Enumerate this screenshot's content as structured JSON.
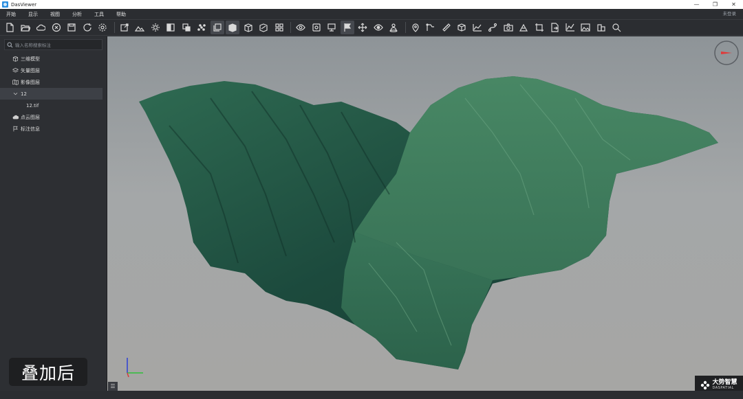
{
  "window": {
    "title": "DasViewer"
  },
  "menu": {
    "items": [
      "开始",
      "显示",
      "视图",
      "分析",
      "工具",
      "帮助"
    ],
    "login": "未登录"
  },
  "toolbar": {
    "groups": [
      [
        "file-new-icon",
        "folder-open-icon",
        "cloud-icon",
        "close-circle-icon",
        "save-icon",
        "refresh-icon",
        "settings-icon"
      ],
      [
        "export-icon",
        "terrain-icon",
        "light-icon",
        "layer-split-icon",
        "clip-icon",
        "point-cloud-icon",
        "stack-icon",
        "box-icon",
        "cube-frame-icon",
        "cube-cut-icon",
        "grid-icon"
      ],
      [
        "eye-icon",
        "frame-icon",
        "monitor-icon",
        "flag-pole-icon",
        "move-icon",
        "view-rotate-icon",
        "person-icon"
      ],
      [
        "pin-icon",
        "polyline-icon",
        "ruler-icon",
        "volume-icon",
        "profile-chart-icon",
        "route-icon",
        "camera-icon",
        "area-icon",
        "crop-icon",
        "file-export-icon",
        "chart-line-icon",
        "image-icon",
        "building-icon",
        "zoom-icon"
      ]
    ],
    "active": [
      "stack-icon",
      "box-icon",
      "flag-pole-icon"
    ]
  },
  "sidebar": {
    "search_placeholder": "输入名称搜索标注",
    "items": [
      {
        "label": "三维模型",
        "icon": "cube-icon",
        "indent": 0
      },
      {
        "label": "矢量图层",
        "icon": "layers-icon",
        "indent": 0
      },
      {
        "label": "影像图层",
        "icon": "map-icon",
        "indent": 0
      },
      {
        "label": "12",
        "icon": "chevron-down-icon",
        "indent": 1,
        "selected": true
      },
      {
        "label": "12.tif",
        "icon": "",
        "indent": 2
      },
      {
        "label": "点云图层",
        "icon": "cloud-points-icon",
        "indent": 0
      },
      {
        "label": "标注信息",
        "icon": "flag-icon",
        "indent": 0
      }
    ]
  },
  "overlay": {
    "caption": "叠加后",
    "brand_name": "大势智慧",
    "brand_sub": "DASPATIAL"
  },
  "colors": {
    "compass_arrow": "#e03a3a",
    "terrain_dark": "#183f36",
    "terrain_light": "#3d7a5c"
  }
}
